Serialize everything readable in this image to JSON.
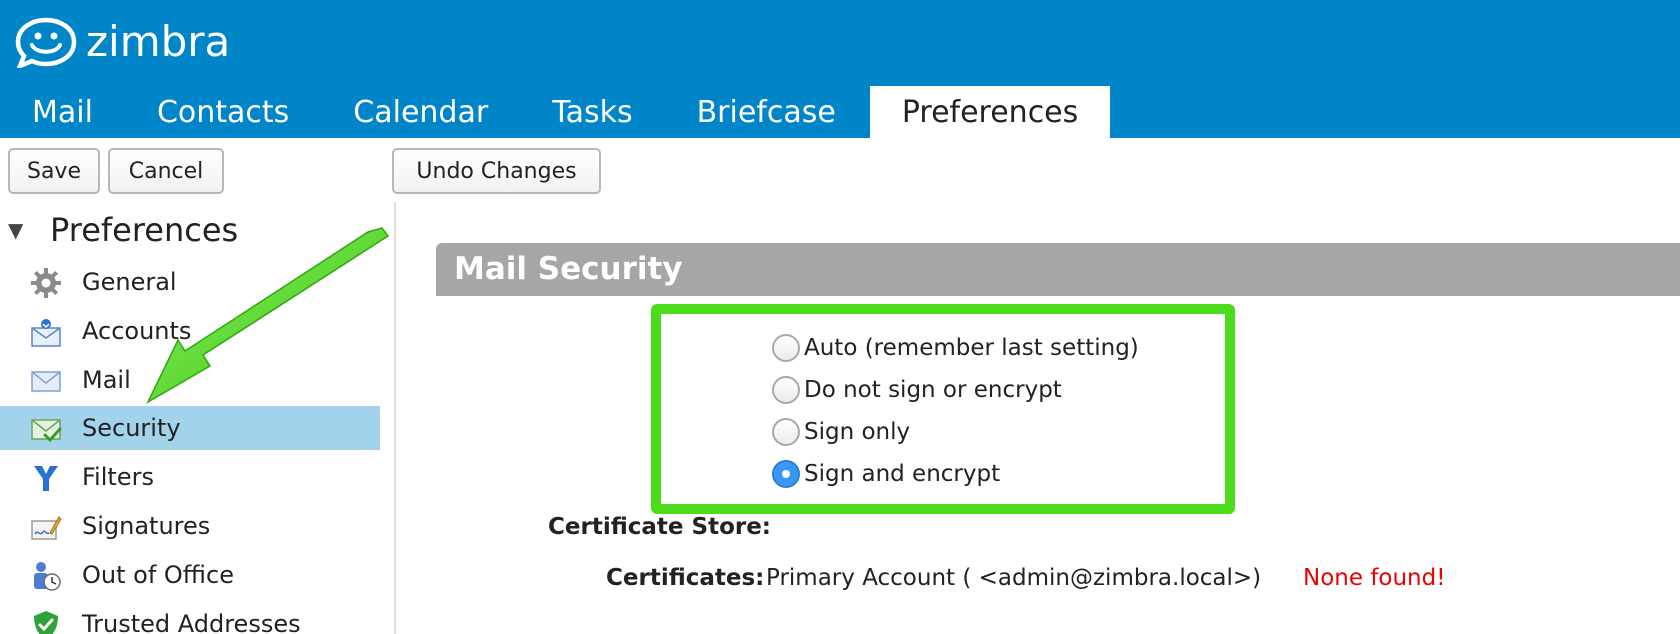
{
  "brand": {
    "name": "zimbra"
  },
  "tabs": [
    {
      "label": "Mail"
    },
    {
      "label": "Contacts"
    },
    {
      "label": "Calendar"
    },
    {
      "label": "Tasks"
    },
    {
      "label": "Briefcase"
    },
    {
      "label": "Preferences",
      "active": true
    }
  ],
  "toolbar": {
    "save_label": "Save",
    "cancel_label": "Cancel",
    "undo_label": "Undo Changes"
  },
  "sidebar": {
    "title": "Preferences",
    "items": [
      {
        "label": "General",
        "icon": "gear-icon"
      },
      {
        "label": "Accounts",
        "icon": "accounts-icon"
      },
      {
        "label": "Mail",
        "icon": "envelope-icon"
      },
      {
        "label": "Security",
        "icon": "secure-mail-icon",
        "selected": true
      },
      {
        "label": "Filters",
        "icon": "filter-icon"
      },
      {
        "label": "Signatures",
        "icon": "signature-icon"
      },
      {
        "label": "Out of Office",
        "icon": "out-of-office-icon"
      },
      {
        "label": "Trusted Addresses",
        "icon": "shield-check-icon"
      }
    ]
  },
  "main": {
    "section_title": "Mail Security",
    "options": [
      {
        "label": "Auto (remember last setting)",
        "checked": false
      },
      {
        "label": "Do not sign or encrypt",
        "checked": false
      },
      {
        "label": "Sign only",
        "checked": false
      },
      {
        "label": "Sign and encrypt",
        "checked": true
      }
    ],
    "certificate_store_label": "Certificate Store:",
    "certificates_label": "Certificates:",
    "certificates_value": "Primary Account ( <admin@zimbra.local>)",
    "certificates_status": "None found!"
  },
  "colors": {
    "header": "#0086c8",
    "selected_row": "#a3d3ea",
    "section_bar": "#a6a6a6",
    "highlight": "#4cdc1c",
    "error": "#ee0000",
    "radio_checked": "#3a97f3"
  }
}
